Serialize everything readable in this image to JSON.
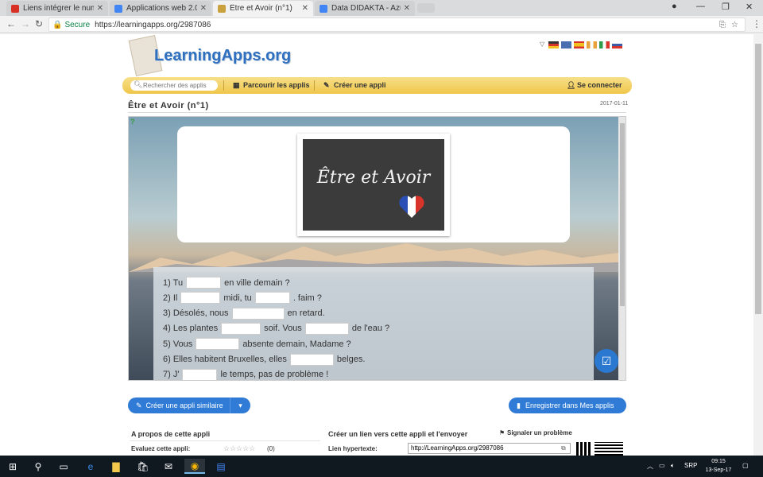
{
  "browser": {
    "tabs": [
      {
        "title": "Liens intégrer le numéric",
        "icon": "gmail-icon",
        "color": "#d93025"
      },
      {
        "title": "Applications web 2.0 pou",
        "icon": "docs-icon",
        "color": "#4285f4"
      },
      {
        "title": "Être et Avoir (n°1)",
        "icon": "learningapps-icon",
        "color": "#c9a23d"
      },
      {
        "title": "Data DIDAKTA - Azurna",
        "icon": "docs-icon",
        "color": "#4285f4"
      }
    ],
    "address": {
      "secure_label": "Secure",
      "url": "https://learningapps.org/2987086"
    }
  },
  "site": {
    "logo": "LearningApps.org",
    "search_placeholder": "Rechercher des applis",
    "nav": {
      "browse": "Parcourir les applis",
      "create": "Créer une appli",
      "login": "Se connecter"
    },
    "flags": [
      "#333333",
      "#4a6fb0",
      "#d9342b",
      "#e8a33a",
      "#2f9a4a",
      "#3d5aa6"
    ]
  },
  "app": {
    "title": "Être et Avoir (n°1)",
    "date": "2017-01-11",
    "card_text": "Être et Avoir",
    "lines": [
      [
        {
          "t": "1) Tu"
        },
        {
          "blank": 44
        },
        {
          "t": "en ville demain ?"
        }
      ],
      [
        {
          "t": "2) Il"
        },
        {
          "blank": 50
        },
        {
          "t": "midi, tu"
        },
        {
          "blank": 44
        },
        {
          "t": ". faim ?"
        }
      ],
      [
        {
          "t": "3) Désolés, nous"
        },
        {
          "blank": 66
        },
        {
          "t": "en retard."
        }
      ],
      [
        {
          "t": "4) Les plantes"
        },
        {
          "blank": 50
        },
        {
          "t": "soif. Vous"
        },
        {
          "blank": 55
        },
        {
          "t": "de l'eau ?"
        }
      ],
      [
        {
          "t": "5) Vous"
        },
        {
          "blank": 55
        },
        {
          "t": "absente demain, Madame ?"
        }
      ],
      [
        {
          "t": "6) Elles habitent Bruxelles, elles"
        },
        {
          "blank": 55
        },
        {
          "t": "belges."
        }
      ],
      [
        {
          "t": "7) J'"
        },
        {
          "blank": 44
        },
        {
          "t": "le temps, pas de problème !"
        }
      ]
    ]
  },
  "actions": {
    "create_similar": "Créer une appli similaire",
    "save_mine": "Enregistrer dans Mes applis"
  },
  "bottom": {
    "about_heading": "A propos de cette appli",
    "rate_label": "Evaluez cette appli:",
    "rate_count": "(0)",
    "link_heading": "Créer un lien vers cette appli et l'envoyer",
    "report": "Signaler un problème",
    "hyperlink_label": "Lien hypertexte:",
    "hyperlink_value": "http://LearningApps.org/2987086"
  },
  "taskbar": {
    "lang": "SRP",
    "time": "09:15",
    "date": "13-Sep-17"
  }
}
